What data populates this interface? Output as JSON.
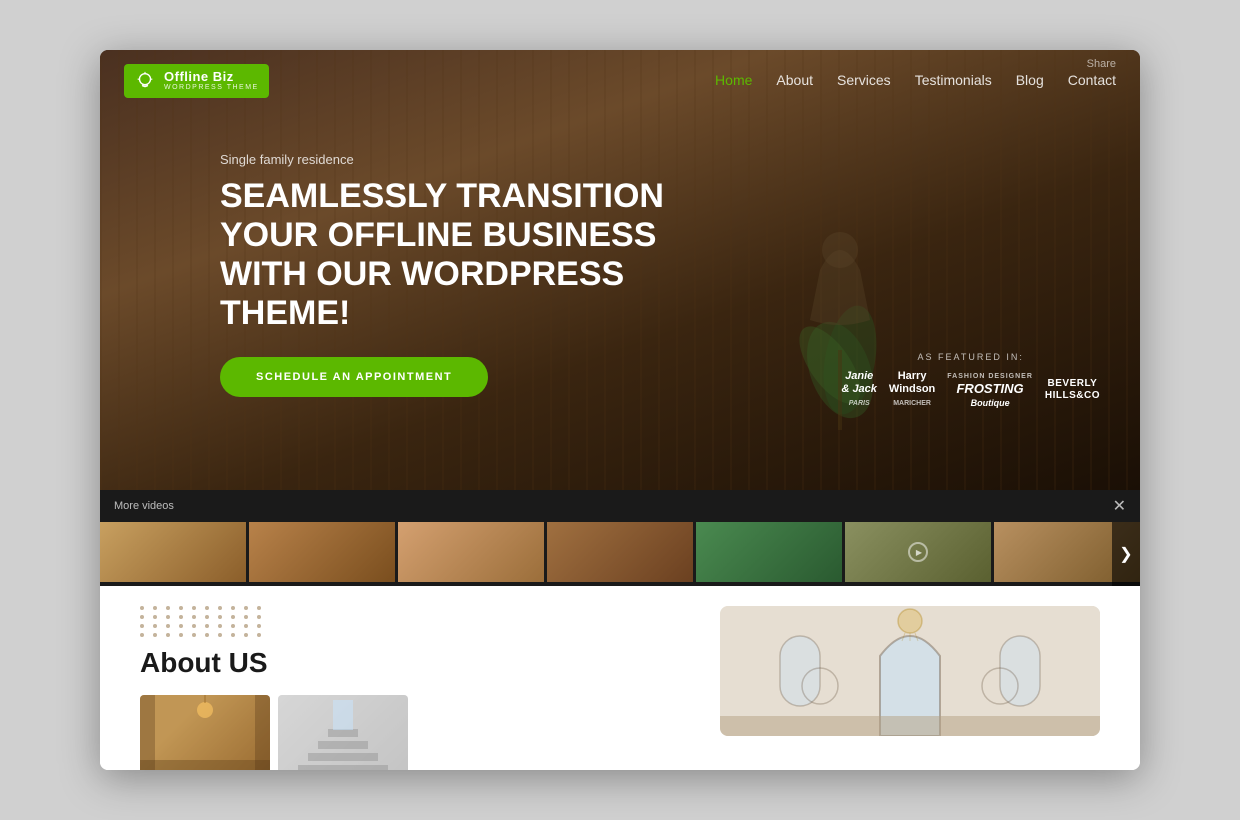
{
  "browser": {
    "share_label": "Share"
  },
  "logo": {
    "title": "Offline Biz",
    "subtitle": "WORDPRESS THEME",
    "icon": "💡"
  },
  "nav": {
    "links": [
      {
        "label": "Home",
        "active": true
      },
      {
        "label": "About",
        "active": false
      },
      {
        "label": "Services",
        "active": false
      },
      {
        "label": "Testimonials",
        "active": false
      },
      {
        "label": "Blog",
        "active": false
      },
      {
        "label": "Contact",
        "active": false
      }
    ]
  },
  "hero": {
    "subtitle": "Single family residence",
    "title": "SEAMLESSLY TRANSITION YOUR OFFLINE BUSINESS WITH OUR WORDPRESS THEME!",
    "cta_label": "SCHEDULE AN APPOINTMENT",
    "featured_label": "AS FEATURED IN:",
    "brands": [
      {
        "name": "Janie\n& Jack",
        "style": "serif"
      },
      {
        "name": "Harry\nWindson",
        "style": "normal"
      },
      {
        "name": "FROSTING\nBoutique",
        "style": "small"
      },
      {
        "name": "BEVERLY\nHILLS&CO",
        "style": "normal"
      }
    ]
  },
  "video_strip": {
    "label": "More videos",
    "close_icon": "✕",
    "next_icon": "❯",
    "thumbs": [
      1,
      2,
      3,
      4,
      5,
      6,
      7
    ]
  },
  "about": {
    "title": "About US",
    "dot_rows": 4,
    "dot_cols": 10
  },
  "colors": {
    "green": "#5cb800",
    "dark": "#1a1a1a",
    "brown": "#8b5e2a"
  }
}
